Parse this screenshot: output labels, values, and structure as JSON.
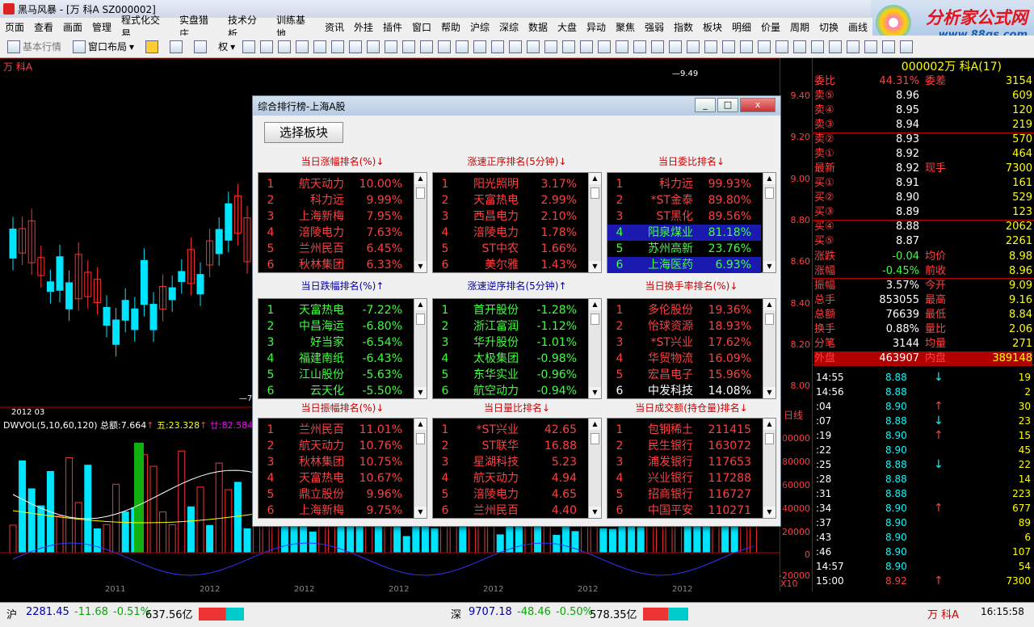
{
  "window": {
    "title": "黑马风暴 - [万  科A  SZ000002]"
  },
  "menu": [
    "页面",
    "查看",
    "画面",
    "管理",
    "程式化交易",
    "实盘猎庄",
    "技术分析",
    "训练基地",
    "资讯",
    "外挂",
    "插件",
    "窗口",
    "帮助",
    "沪综",
    "深综",
    "数据",
    "大盘",
    "异动",
    "聚焦",
    "强弱",
    "指数",
    "板块",
    "明细",
    "价量",
    "周期",
    "切换",
    "画线"
  ],
  "toolbar": {
    "basic_quote": "基本行情",
    "window_layout": "窗口布局",
    "quan": "权"
  },
  "logo": {
    "line1": "分析家公式网",
    "line2": "www.88gs.com"
  },
  "chart": {
    "stock_label": "万  科A",
    "high_marker": "9.49",
    "low_marker": "7.",
    "date_label": "2012   03",
    "indicator": "DWVOL(5,10,60,120)",
    "indicator_total": "总额:7.664",
    "indicator_five": "五:23.328",
    "indicator_twenty": "廿:82.584",
    "x_labels": [
      "2011",
      "2012",
      "2012",
      "2012",
      "2012",
      "2012",
      "2012"
    ],
    "period": "日线",
    "scale": "X10",
    "price_ticks": [
      "9.40",
      "9.20",
      "9.00",
      "8.80",
      "8.60",
      "8.40",
      "8.20",
      "8.00"
    ],
    "vol_ticks": [
      "100000",
      "80000",
      "60000",
      "40000",
      "20000",
      "0",
      "-20000"
    ],
    "colors": {
      "up": "#ff3030",
      "down": "#00e5ff",
      "bg": "#000000"
    }
  },
  "dialog": {
    "title": "综合排行榜-上海A股",
    "select_button": "选择板块",
    "minimize": "_",
    "maximize": "□",
    "close": "x",
    "panels": [
      {
        "title": "当日涨幅排名(%)↓",
        "rows": [
          {
            "n": "1",
            "name": "航天动力",
            "val": "10.00%"
          },
          {
            "n": "2",
            "name": "科力远",
            "val": "9.99%"
          },
          {
            "n": "3",
            "name": "上海新梅",
            "val": "7.95%"
          },
          {
            "n": "4",
            "name": "涪陵电力",
            "val": "7.63%"
          },
          {
            "n": "5",
            "name": "兰州民百",
            "val": "6.45%"
          },
          {
            "n": "6",
            "name": "秋林集团",
            "val": "6.33%"
          }
        ]
      },
      {
        "title": "涨速正序排名(5分钟)↓",
        "rows": [
          {
            "n": "1",
            "name": "阳光照明",
            "val": "3.17%"
          },
          {
            "n": "2",
            "name": "天富热电",
            "val": "2.99%"
          },
          {
            "n": "3",
            "name": "西昌电力",
            "val": "2.10%"
          },
          {
            "n": "4",
            "name": "涪陵电力",
            "val": "1.78%"
          },
          {
            "n": "5",
            "name": "ST中农",
            "val": "1.66%"
          },
          {
            "n": "6",
            "name": "美尔雅",
            "val": "1.43%"
          }
        ]
      },
      {
        "title": "当日委比排名↓",
        "rows": [
          {
            "n": "1",
            "name": "科力远",
            "val": "99.93%"
          },
          {
            "n": "2",
            "name": "*ST金泰",
            "val": "89.80%"
          },
          {
            "n": "3",
            "name": "ST黑化",
            "val": "89.56%"
          },
          {
            "n": "4",
            "name": "阳泉煤业",
            "val": "81.18%"
          },
          {
            "n": "5",
            "name": "苏州高新",
            "val": "23.76%"
          },
          {
            "n": "6",
            "name": "上海医药",
            "val": "6.93%"
          }
        ]
      },
      {
        "title": "当日跌幅排名(%)↑",
        "rows": [
          {
            "n": "1",
            "name": "天富热电",
            "val": "-7.22%"
          },
          {
            "n": "2",
            "name": "中昌海运",
            "val": "-6.80%"
          },
          {
            "n": "3",
            "name": "好当家",
            "val": "-6.54%"
          },
          {
            "n": "4",
            "name": "福建南纸",
            "val": "-6.43%"
          },
          {
            "n": "5",
            "name": "江山股份",
            "val": "-5.63%"
          },
          {
            "n": "6",
            "name": "云天化",
            "val": "-5.50%"
          }
        ]
      },
      {
        "title": "涨速逆序排名(5分钟)↑",
        "rows": [
          {
            "n": "1",
            "name": "首开股份",
            "val": "-1.28%"
          },
          {
            "n": "2",
            "name": "浙江富润",
            "val": "-1.12%"
          },
          {
            "n": "3",
            "name": "华升股份",
            "val": "-1.01%"
          },
          {
            "n": "4",
            "name": "太极集团",
            "val": "-0.98%"
          },
          {
            "n": "5",
            "name": "东华实业",
            "val": "-0.96%"
          },
          {
            "n": "6",
            "name": "航空动力",
            "val": "-0.94%"
          }
        ]
      },
      {
        "title": "当日换手率排名(%)↓",
        "rows": [
          {
            "n": "1",
            "name": "多伦股份",
            "val": "19.36%"
          },
          {
            "n": "2",
            "name": "怡球资源",
            "val": "18.93%"
          },
          {
            "n": "3",
            "name": "*ST兴业",
            "val": "17.62%"
          },
          {
            "n": "4",
            "name": "华贸物流",
            "val": "16.09%"
          },
          {
            "n": "5",
            "name": "宏昌电子",
            "val": "15.96%"
          },
          {
            "n": "6",
            "name": "中发科技",
            "val": "14.08%"
          }
        ]
      },
      {
        "title": "当日振幅排名(%)↓",
        "rows": [
          {
            "n": "1",
            "name": "兰州民百",
            "val": "11.01%"
          },
          {
            "n": "2",
            "name": "航天动力",
            "val": "10.76%"
          },
          {
            "n": "3",
            "name": "秋林集团",
            "val": "10.75%"
          },
          {
            "n": "4",
            "name": "天富热电",
            "val": "10.67%"
          },
          {
            "n": "5",
            "name": "鼎立股份",
            "val": "9.96%"
          },
          {
            "n": "6",
            "name": "上海新梅",
            "val": "9.75%"
          }
        ]
      },
      {
        "title": "当日量比排名↓",
        "rows": [
          {
            "n": "1",
            "name": "*ST兴业",
            "val": "42.65"
          },
          {
            "n": "2",
            "name": "ST联华",
            "val": "16.88"
          },
          {
            "n": "3",
            "name": "星湖科技",
            "val": "5.23"
          },
          {
            "n": "4",
            "name": "航天动力",
            "val": "4.94"
          },
          {
            "n": "5",
            "name": "涪陵电力",
            "val": "4.65"
          },
          {
            "n": "6",
            "name": "兰州民百",
            "val": "4.40"
          }
        ]
      },
      {
        "title": "当日成交额(持仓量)排名↓",
        "rows": [
          {
            "n": "1",
            "name": "包钢稀土",
            "val": "211415"
          },
          {
            "n": "2",
            "name": "民生银行",
            "val": "163072"
          },
          {
            "n": "3",
            "name": "浦发银行",
            "val": "117653"
          },
          {
            "n": "4",
            "name": "兴业银行",
            "val": "117288"
          },
          {
            "n": "5",
            "name": "招商银行",
            "val": "116727"
          },
          {
            "n": "6",
            "name": "中国平安",
            "val": "110271"
          }
        ]
      }
    ]
  },
  "quote": {
    "header": "000002万  科A(17)",
    "rows": [
      {
        "a": "委比",
        "b": "44.31%",
        "c": "委差",
        "d": "3154"
      },
      {
        "a": "卖⑤",
        "b": "8.96",
        "c": "",
        "d": "609"
      },
      {
        "a": "卖④",
        "b": "8.95",
        "c": "",
        "d": "120"
      },
      {
        "a": "卖③",
        "b": "8.94",
        "c": "",
        "d": "219"
      },
      {
        "a": "卖②",
        "b": "8.93",
        "c": "",
        "d": "570"
      },
      {
        "a": "卖①",
        "b": "8.92",
        "c": "",
        "d": "464"
      },
      {
        "a": "最新",
        "b": "8.92",
        "c": "现手",
        "d": "7300"
      },
      {
        "a": "买①",
        "b": "8.91",
        "c": "",
        "d": "161"
      },
      {
        "a": "买②",
        "b": "8.90",
        "c": "",
        "d": "529"
      },
      {
        "a": "买③",
        "b": "8.89",
        "c": "",
        "d": "123"
      },
      {
        "a": "买④",
        "b": "8.88",
        "c": "",
        "d": "2062"
      },
      {
        "a": "买⑤",
        "b": "8.87",
        "c": "",
        "d": "2261"
      },
      {
        "a": "涨跌",
        "b": "-0.04",
        "c": "均价",
        "d": "8.98"
      },
      {
        "a": "涨幅",
        "b": "-0.45%",
        "c": "前收",
        "d": "8.96"
      },
      {
        "a": "振幅",
        "b": "3.57%",
        "c": "今开",
        "d": "9.09"
      },
      {
        "a": "总手",
        "b": "853055",
        "c": "最高",
        "d": "9.16"
      },
      {
        "a": "总额",
        "b": "76639",
        "c": "最低",
        "d": "8.84"
      },
      {
        "a": "换手",
        "b": "0.88%",
        "c": "量比",
        "d": "2.06"
      },
      {
        "a": "分笔",
        "b": "3144",
        "c": "均量",
        "d": "271"
      },
      {
        "a": "外盘",
        "b": "463907",
        "c": "内盘",
        "d": "389148"
      }
    ],
    "ticks": [
      {
        "t": "14:55",
        "p": "8.88",
        "dir": "down",
        "v": "19"
      },
      {
        "t": "14:56",
        "p": "8.88",
        "dir": "",
        "v": "2"
      },
      {
        "t": ":04",
        "p": "8.90",
        "dir": "up",
        "v": "30"
      },
      {
        "t": ":07",
        "p": "8.88",
        "dir": "down",
        "v": "23"
      },
      {
        "t": ":19",
        "p": "8.90",
        "dir": "up",
        "v": "15"
      },
      {
        "t": ":22",
        "p": "8.90",
        "dir": "",
        "v": "45"
      },
      {
        "t": ":25",
        "p": "8.88",
        "dir": "down",
        "v": "22"
      },
      {
        "t": ":28",
        "p": "8.88",
        "dir": "",
        "v": "14"
      },
      {
        "t": ":31",
        "p": "8.88",
        "dir": "",
        "v": "223"
      },
      {
        "t": ":34",
        "p": "8.90",
        "dir": "up",
        "v": "677"
      },
      {
        "t": ":37",
        "p": "8.90",
        "dir": "",
        "v": "89"
      },
      {
        "t": ":43",
        "p": "8.90",
        "dir": "",
        "v": "6"
      },
      {
        "t": ":46",
        "p": "8.90",
        "dir": "",
        "v": "107"
      },
      {
        "t": "14:57",
        "p": "8.90",
        "dir": "",
        "v": "54"
      },
      {
        "t": "15:00",
        "p": "8.92",
        "dir": "up",
        "v": "7300"
      }
    ]
  },
  "status": {
    "sh_label": "沪",
    "sh_index": "2281.45",
    "sh_change": "-11.68",
    "sh_pct": "-0.51%",
    "sh_amount": "637.56亿",
    "sz_label": "深",
    "sz_index": "9707.18",
    "sz_change": "-48.46",
    "sz_pct": "-0.50%",
    "sz_amount": "578.35亿",
    "stock": "万  科A",
    "time": "16:15:58"
  }
}
